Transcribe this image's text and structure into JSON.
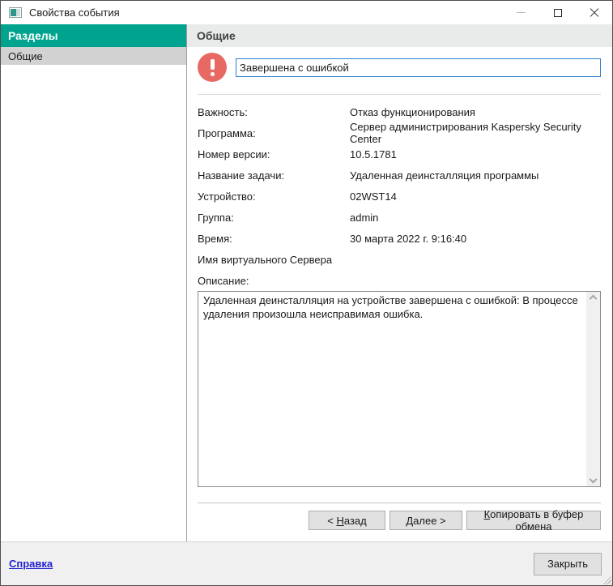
{
  "colors": {
    "accent_teal": "#00a48e",
    "error_red": "#e66a63",
    "link_blue": "#2323d4",
    "input_focus_blue": "#2f80d0"
  },
  "window": {
    "title": "Свойства события"
  },
  "sidebar": {
    "header": "Разделы",
    "items": [
      {
        "label": "Общие",
        "selected": true
      }
    ]
  },
  "main": {
    "header": "Общие",
    "event_input": {
      "value": "Завершена с ошибкой"
    },
    "fields": [
      {
        "label": "Важность:",
        "value": "Отказ функционирования"
      },
      {
        "label": "Программа:",
        "value": "Сервер администрирования Kaspersky Security Center"
      },
      {
        "label": "Номер версии:",
        "value": "10.5.1781"
      },
      {
        "label": "Название задачи:",
        "value": "Удаленная деинсталляция программы"
      },
      {
        "label": "Устройство:",
        "value": "02WST14"
      },
      {
        "label": "Группа:",
        "value": "admin"
      },
      {
        "label": "Время:",
        "value": "30 марта 2022 г. 9:16:40"
      },
      {
        "label": "Имя виртуального Сервера",
        "value": ""
      }
    ],
    "description": {
      "label": "Описание:",
      "text": "Удаленная деинсталляция на устройстве завершена с ошибкой: В процессе удаления произошла неисправимая ошибка."
    },
    "buttons": {
      "back": {
        "pre": "< ",
        "mnemonic": "Н",
        "rest": "азад"
      },
      "next": {
        "pre": "",
        "mnemonic": "Д",
        "rest": "алее >"
      },
      "copy": {
        "pre": "",
        "mnemonic": "К",
        "rest": "опировать в буфер обмена"
      }
    }
  },
  "footer": {
    "help": "Справка",
    "close": "Закрыть"
  }
}
